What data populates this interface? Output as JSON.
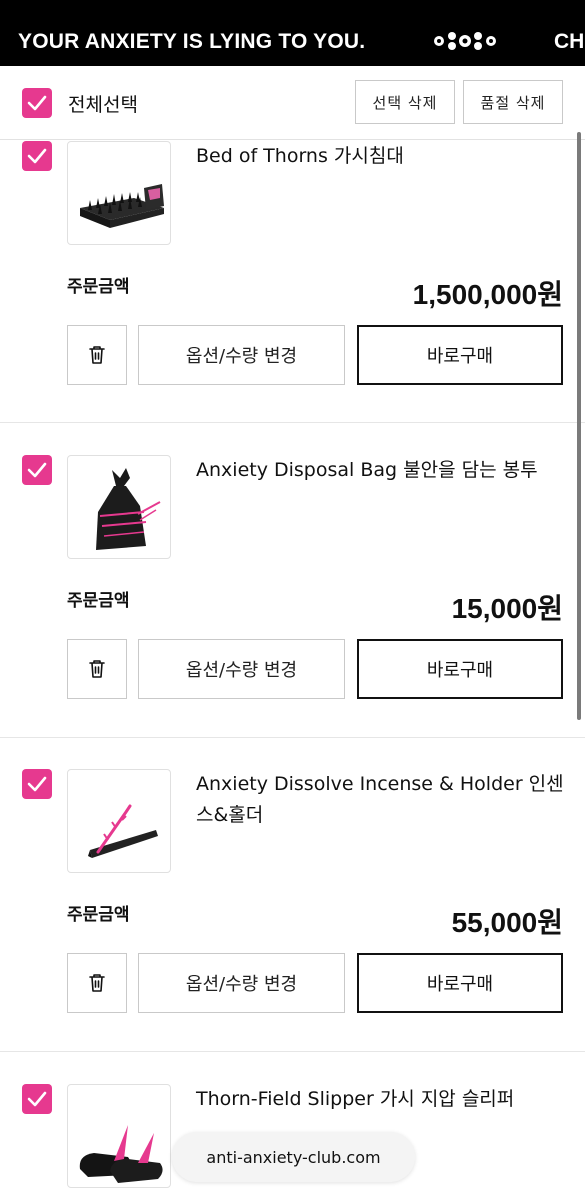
{
  "banner": {
    "text": "YOUR ANXIETY IS LYING TO YOU.",
    "text_next": "CH",
    "logo_icon": "club-logo-icon"
  },
  "select_bar": {
    "select_all_label": "전체선택",
    "delete_selected_label": "선택 삭제",
    "delete_soldout_label": "품절 삭제"
  },
  "colors": {
    "accent": "#e6398f",
    "banner_bg": "#000000"
  },
  "items": [
    {
      "name": "Bed of Thorns 가시침대",
      "price_label": "주문금액",
      "price": "1,500,000원",
      "delete_icon": "trash-icon",
      "option_label": "옵션/수량 변경",
      "buy_label": "바로구매"
    },
    {
      "name": "Anxiety Disposal Bag 불안을 담는 봉투",
      "price_label": "주문금액",
      "price": "15,000원",
      "delete_icon": "trash-icon",
      "option_label": "옵션/수량 변경",
      "buy_label": "바로구매"
    },
    {
      "name": "Anxiety Dissolve Incense & Holder 인센스&홀더",
      "price_label": "주문금액",
      "price": "55,000원",
      "delete_icon": "trash-icon",
      "option_label": "옵션/수량 변경",
      "buy_label": "바로구매"
    },
    {
      "name": "Thorn-Field Slipper 가시 지압 슬리퍼"
    }
  ],
  "browser": {
    "url": "anti-anxiety-club.com"
  }
}
